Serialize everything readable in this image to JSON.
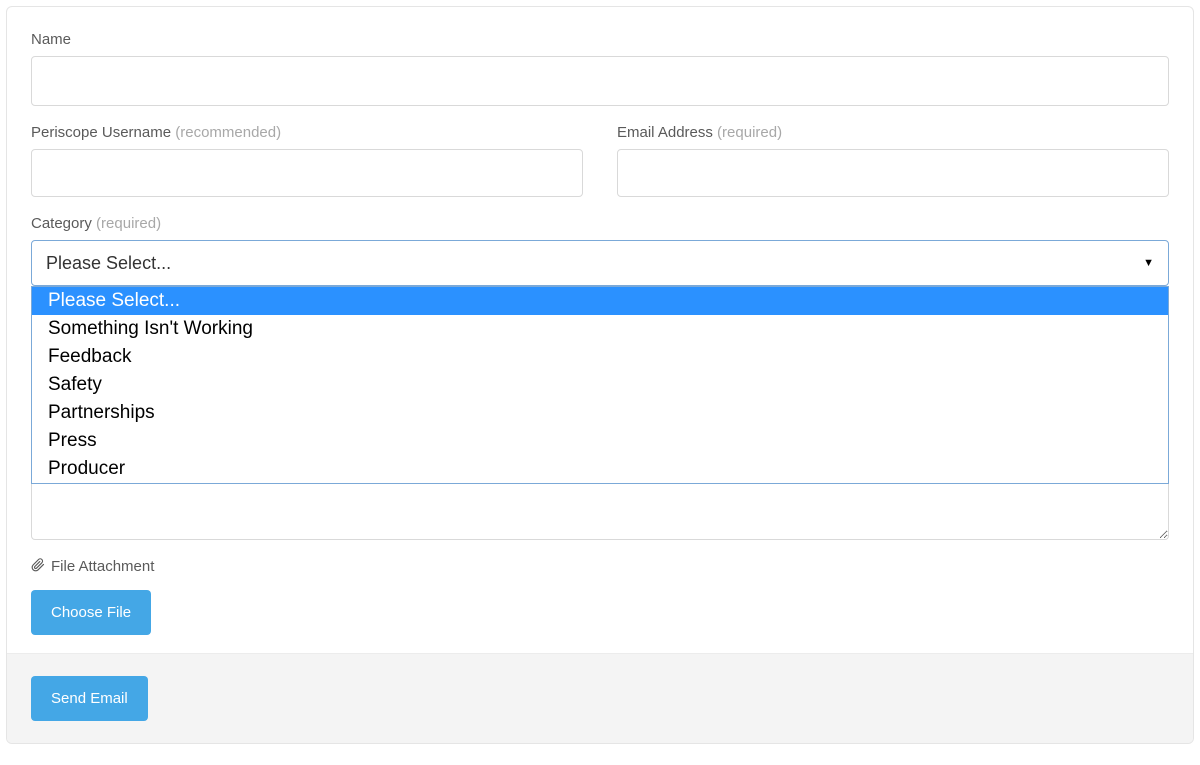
{
  "form": {
    "name": {
      "label": "Name",
      "value": ""
    },
    "username": {
      "label": "Periscope Username ",
      "hint": "(recommended)",
      "value": ""
    },
    "email": {
      "label": "Email Address ",
      "hint": "(required)",
      "value": ""
    },
    "category": {
      "label": "Category ",
      "hint": "(required)",
      "selected": "Please Select...",
      "options": [
        "Please Select...",
        "Something Isn't Working",
        "Feedback",
        "Safety",
        "Partnerships",
        "Press",
        "Producer"
      ]
    },
    "message": {
      "value": ""
    },
    "attachment": {
      "label": "File Attachment",
      "button": "Choose File"
    },
    "submit": {
      "label": "Send Email"
    }
  },
  "colors": {
    "accent": "#44a7e6",
    "highlight": "#2b91ff",
    "borderFocus": "#7ba9d8"
  }
}
